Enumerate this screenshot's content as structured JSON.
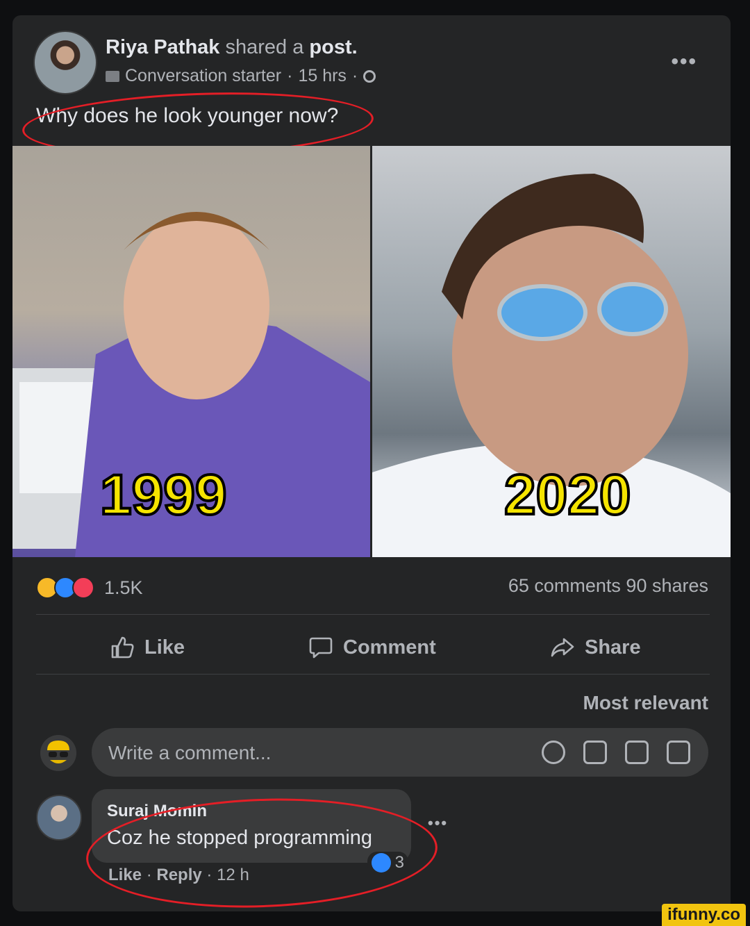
{
  "post": {
    "author": "Riya Pathak",
    "action_text": "shared a",
    "object_text": "post.",
    "group_label": "Conversation starter",
    "time": "15 hrs",
    "caption": "Why does he look younger now?",
    "images": [
      {
        "year": "1999"
      },
      {
        "year": "2020"
      }
    ],
    "reaction_count": "1.5K",
    "comments_count": "65 comments",
    "shares_count": "90 shares",
    "actions": {
      "like": "Like",
      "comment": "Comment",
      "share": "Share"
    },
    "sort_label": "Most relevant"
  },
  "composer": {
    "placeholder": "Write a comment..."
  },
  "comment": {
    "author": "Suraj Momin",
    "text": "Coz he stopped programming",
    "like_label": "Like",
    "reply_label": "Reply",
    "time": "12 h",
    "reaction_count": "3"
  },
  "watermark": "ifunny.co",
  "colors": {
    "background": "#0e0f11",
    "card": "#242526",
    "bubble": "#3a3b3c",
    "annotation": "#e41e26",
    "year_label": "#f5e400"
  },
  "icons": [
    "group-icon",
    "globe-icon",
    "more-icon",
    "haha-icon",
    "like-icon",
    "love-icon",
    "thumb-icon",
    "comment-icon",
    "share-icon",
    "emoji-icon",
    "camera-icon",
    "gif-icon",
    "sticker-icon"
  ]
}
